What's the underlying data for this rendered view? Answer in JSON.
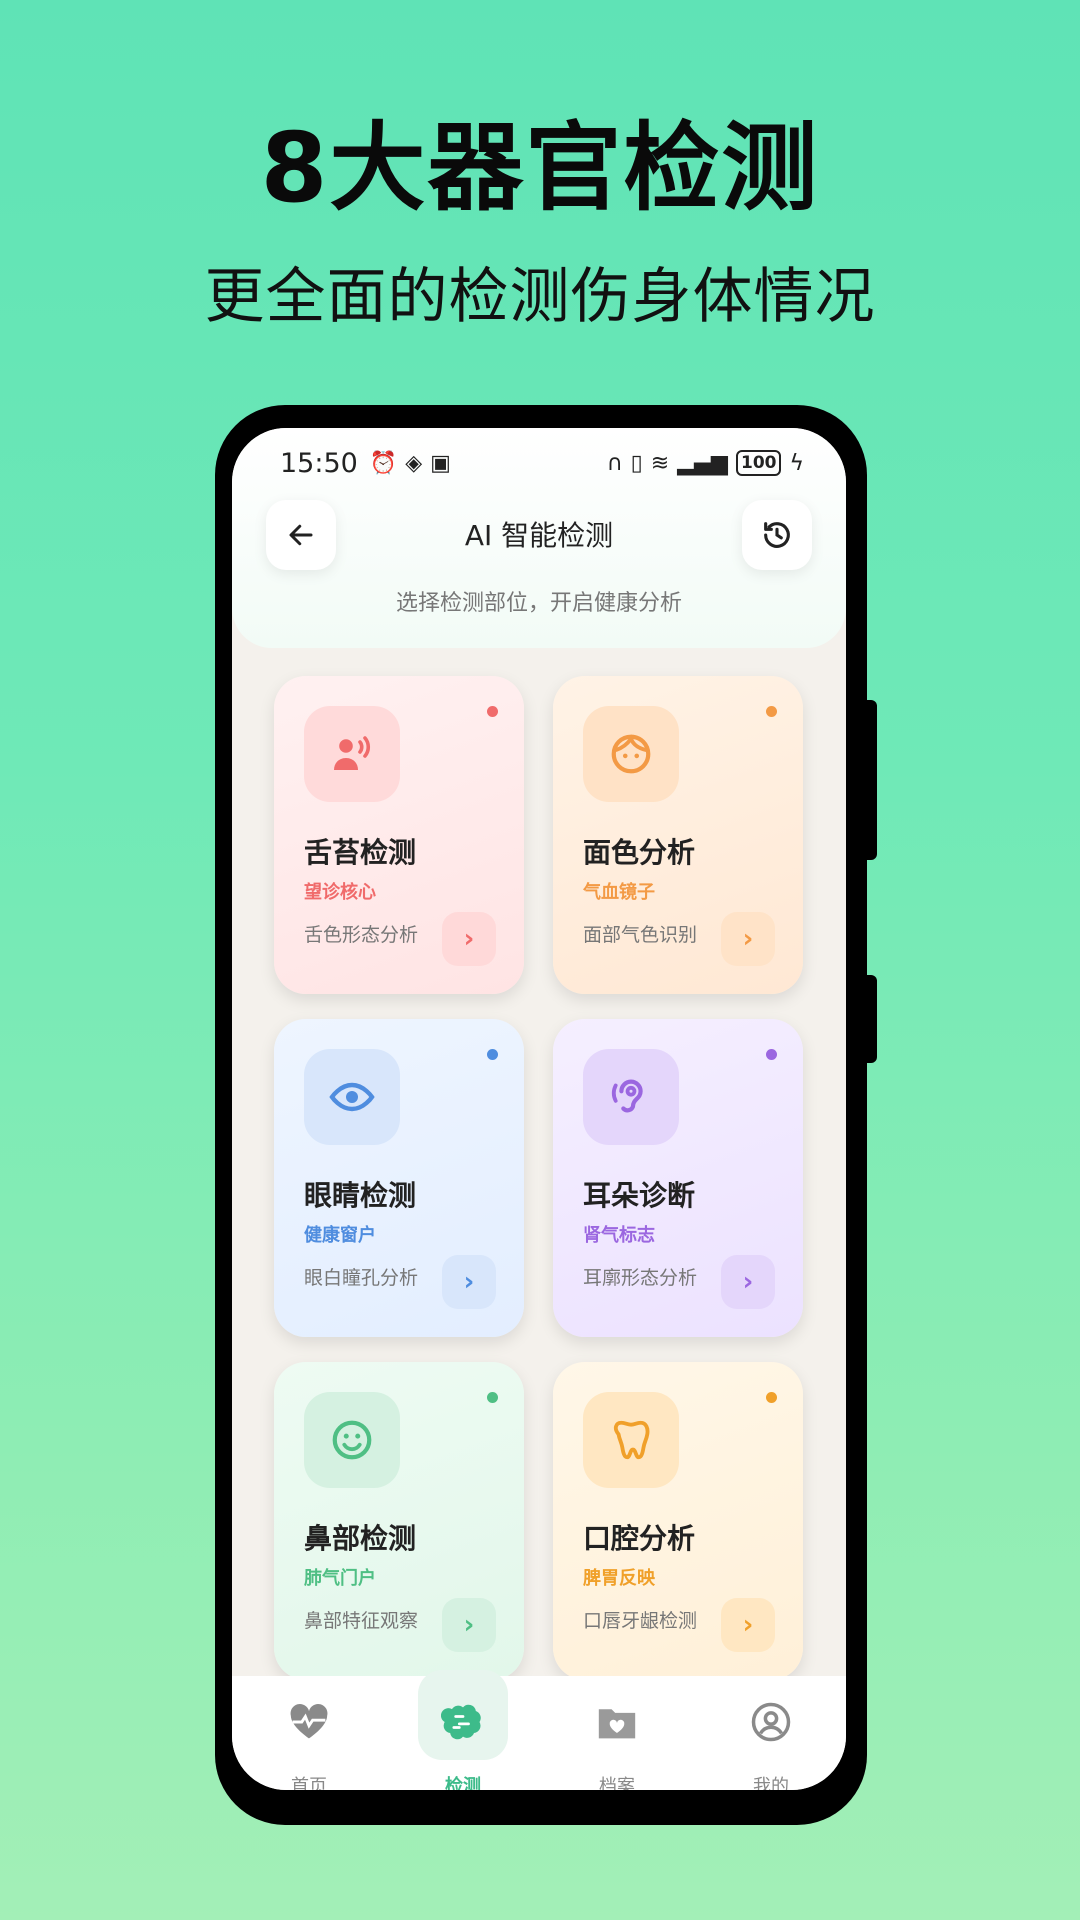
{
  "hero": {
    "title": "8大器官检测",
    "subtitle": "更全面的检测伤身体情况"
  },
  "status_bar": {
    "time": "15:50",
    "battery": "100"
  },
  "header": {
    "title": "AI 智能检测",
    "subtitle": "选择检测部位，开启健康分析",
    "back_icon": "arrow-left-icon",
    "history_icon": "history-icon"
  },
  "cards": [
    {
      "title": "舌苔检测",
      "tag": "望诊核心",
      "desc": "舌色形态分析",
      "accent": "#f06b6b",
      "icon": "person-speaking-icon"
    },
    {
      "title": "面色分析",
      "tag": "气血镜子",
      "desc": "面部气色识别",
      "accent": "#f39a45",
      "icon": "face-icon"
    },
    {
      "title": "眼睛检测",
      "tag": "健康窗户",
      "desc": "眼白瞳孔分析",
      "accent": "#4f8ddf",
      "icon": "eye-icon"
    },
    {
      "title": "耳朵诊断",
      "tag": "肾气标志",
      "desc": "耳廓形态分析",
      "accent": "#9b67e0",
      "icon": "ear-icon"
    },
    {
      "title": "鼻部检测",
      "tag": "肺气门户",
      "desc": "鼻部特征观察",
      "accent": "#4fbf84",
      "icon": "smile-icon"
    },
    {
      "title": "口腔分析",
      "tag": "脾胃反映",
      "desc": "口唇牙龈检测",
      "accent": "#f0a02a",
      "icon": "tooth-icon"
    }
  ],
  "tabs": [
    {
      "label": "首页",
      "icon": "heartbeat-icon"
    },
    {
      "label": "检测",
      "icon": "brain-icon"
    },
    {
      "label": "档案",
      "icon": "folder-heart-icon"
    },
    {
      "label": "我的",
      "icon": "user-circle-icon"
    }
  ],
  "active_tab": "检测"
}
